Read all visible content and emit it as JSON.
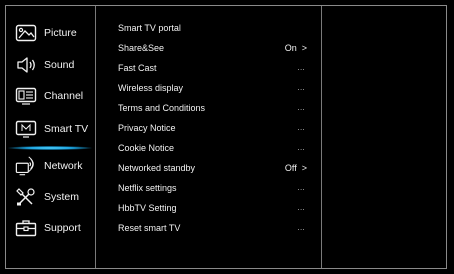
{
  "sidebar": {
    "items": [
      {
        "label": "Picture",
        "icon": "picture-icon"
      },
      {
        "label": "Sound",
        "icon": "speaker-icon"
      },
      {
        "label": "Channel",
        "icon": "channel-icon"
      },
      {
        "label": "Smart TV",
        "icon": "smart-tv-icon"
      },
      {
        "label": "Network",
        "icon": "network-icon"
      },
      {
        "label": "System",
        "icon": "tools-icon"
      },
      {
        "label": "Support",
        "icon": "toolbox-icon"
      }
    ],
    "active": "Smart TV",
    "accent_color": "#1aa3e0"
  },
  "menu": {
    "items": [
      {
        "label": "Smart TV portal",
        "value": ""
      },
      {
        "label": "Share&See",
        "value": "On  >"
      },
      {
        "label": "Fast Cast",
        "value": "..."
      },
      {
        "label": "Wireless display",
        "value": "..."
      },
      {
        "label": "Terms and Conditions",
        "value": "..."
      },
      {
        "label": "Privacy Notice",
        "value": "..."
      },
      {
        "label": "Cookie Notice",
        "value": "..."
      },
      {
        "label": "Networked standby",
        "value": "Off  >"
      },
      {
        "label": "Netflix settings",
        "value": "..."
      },
      {
        "label": "HbbTV Setting",
        "value": "..."
      },
      {
        "label": "Reset smart TV",
        "value": "..."
      }
    ]
  }
}
